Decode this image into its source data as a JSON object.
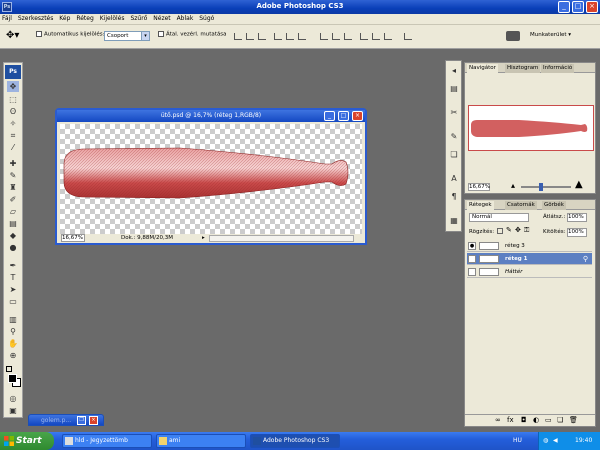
{
  "app": {
    "title": "Adobe Photoshop CS3",
    "icon": "Ps"
  },
  "menu": [
    "Fájl",
    "Szerkesztés",
    "Kép",
    "Réteg",
    "Kijelölés",
    "Szűrő",
    "Nézet",
    "Ablak",
    "Súgó"
  ],
  "options": {
    "auto_select_label": "Automatikus kijelölés:",
    "auto_select_value": "Csoport",
    "transform_label": "Átal. vezérl. mutatása",
    "workspace_label": "Munkaterület"
  },
  "document": {
    "title": "ütő.psd @ 16,7% (réteg 1,RGB/8)",
    "zoom": "16,67%",
    "doc_info": "Dok.: 9,88M/20,3M"
  },
  "navigator": {
    "tabs": [
      "Navigátor",
      "Hisztogram",
      "Információ"
    ],
    "zoom": "16,67%"
  },
  "layers": {
    "tabs": [
      "Rétegek",
      "Csatornák",
      "Görbék"
    ],
    "blend_mode": "Normál",
    "opacity_label": "Átlátsz.:",
    "opacity_value": "100%",
    "lock_label": "Rögzítés:",
    "fill_label": "Kitöltés:",
    "fill_value": "100%",
    "items": [
      {
        "name": "réteg 3",
        "visible": true,
        "selected": false
      },
      {
        "name": "réteg 1",
        "visible": false,
        "selected": true
      },
      {
        "name": "Háttér",
        "visible": false,
        "selected": false
      }
    ]
  },
  "minimized_window": {
    "title": "golem.p..."
  },
  "taskbar": {
    "start_label": "Start",
    "items": [
      {
        "label": "hld - Jegyzettömb",
        "active": false
      },
      {
        "label": "ami",
        "active": false
      },
      {
        "label": "Adobe Photoshop CS3",
        "active": true
      }
    ],
    "lang": "HU",
    "clock": "19:40"
  },
  "colors": {
    "bat": "#c94a4a",
    "xp_blue": "#245edb",
    "selected_layer": "#5c7fc2"
  }
}
